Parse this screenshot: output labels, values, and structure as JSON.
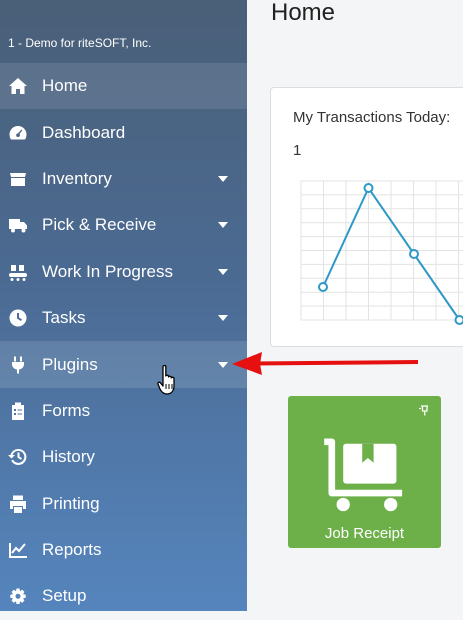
{
  "sidebar": {
    "company": "1 - Demo for riteSOFT, Inc.",
    "items": [
      {
        "label": "Home",
        "icon": "home-icon"
      },
      {
        "label": "Dashboard",
        "icon": "dashboard-gauge-icon"
      },
      {
        "label": "Inventory",
        "icon": "box-icon"
      },
      {
        "label": "Pick & Receive",
        "icon": "truck-icon"
      },
      {
        "label": "Work In Progress",
        "icon": "conveyor-icon"
      },
      {
        "label": "Tasks",
        "icon": "clock-icon"
      },
      {
        "label": "Plugins",
        "icon": "plug-icon"
      },
      {
        "label": "Forms",
        "icon": "clipboard-icon"
      },
      {
        "label": "History",
        "icon": "history-icon"
      },
      {
        "label": "Printing",
        "icon": "printer-icon"
      },
      {
        "label": "Reports",
        "icon": "chart-line-icon"
      },
      {
        "label": "Setup",
        "icon": "gear-icon"
      }
    ]
  },
  "main": {
    "title": "Home",
    "transactions_card": {
      "title": "My Transactions Today:",
      "value": "1"
    },
    "tile": {
      "label": "Job Receipt",
      "icon": "dolly-box-icon",
      "pin_icon": "pin-icon",
      "color": "#6db04a"
    }
  },
  "chart_data": {
    "type": "line",
    "values": [
      1,
      4,
      2,
      0
    ],
    "xlabel": "",
    "ylabel": "",
    "grid": true
  }
}
